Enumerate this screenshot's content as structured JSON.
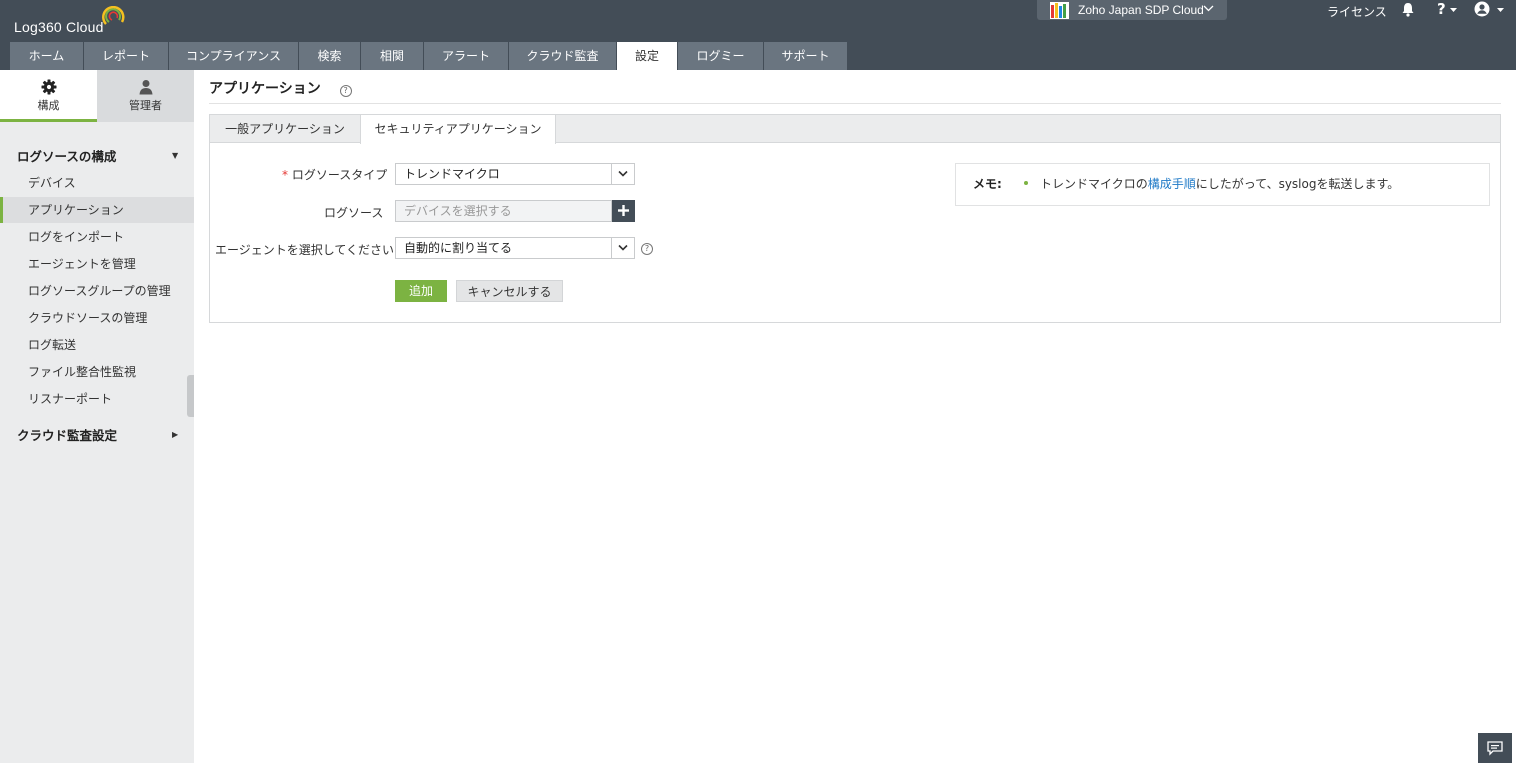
{
  "header": {
    "app_name": "Log360 Cloud",
    "org_name": "Zoho Japan SDP Cloud",
    "license_label": "ライセンス",
    "help_label": "?"
  },
  "nav": {
    "tabs": [
      {
        "label": "ホーム",
        "active": false
      },
      {
        "label": "レポート",
        "active": false
      },
      {
        "label": "コンプライアンス",
        "active": false
      },
      {
        "label": "検索",
        "active": false
      },
      {
        "label": "相関",
        "active": false
      },
      {
        "label": "アラート",
        "active": false
      },
      {
        "label": "クラウド監査",
        "active": false
      },
      {
        "label": "設定",
        "active": true
      },
      {
        "label": "ログミー",
        "active": false
      },
      {
        "label": "サポート",
        "active": false
      }
    ]
  },
  "sidebar": {
    "config_label": "構成",
    "admin_label": "管理者",
    "section1_title": "ログソースの構成",
    "items": [
      {
        "label": "デバイス",
        "active": false
      },
      {
        "label": "アプリケーション",
        "active": true
      },
      {
        "label": "ログをインポート",
        "active": false
      },
      {
        "label": "エージェントを管理",
        "active": false
      },
      {
        "label": "ログソースグループの管理",
        "active": false
      },
      {
        "label": "クラウドソースの管理",
        "active": false
      },
      {
        "label": "ログ転送",
        "active": false
      },
      {
        "label": "ファイル整合性監視",
        "active": false
      },
      {
        "label": "リスナーポート",
        "active": false
      }
    ],
    "section2_title": "クラウド監査設定"
  },
  "main": {
    "page_title": "アプリケーション",
    "tabs": [
      {
        "label": "一般アプリケーション",
        "active": false
      },
      {
        "label": "セキュリティアプリケーション",
        "active": true
      }
    ],
    "form": {
      "required_mark": "*",
      "log_source_type_label": "ログソースタイプ",
      "log_source_type_value": "トレンドマイクロ",
      "log_source_label": "ログソース",
      "log_source_placeholder": "デバイスを選択する",
      "agent_label": "エージェントを選択してください",
      "agent_value": "自動的に割り当てる",
      "add_button": "追加",
      "cancel_button": "キャンセルする"
    },
    "memo": {
      "label": "メモ:",
      "text_before": "トレンドマイクロの",
      "link": "構成手順",
      "text_after": "にしたがって、syslogを転送します。"
    }
  },
  "colors": {
    "header_bg": "#434d57",
    "nav_tab_bg": "#6a7580",
    "accent_green": "#7cb342",
    "sidebar_bg": "#ebeced",
    "link_blue": "#1f7ac7"
  }
}
